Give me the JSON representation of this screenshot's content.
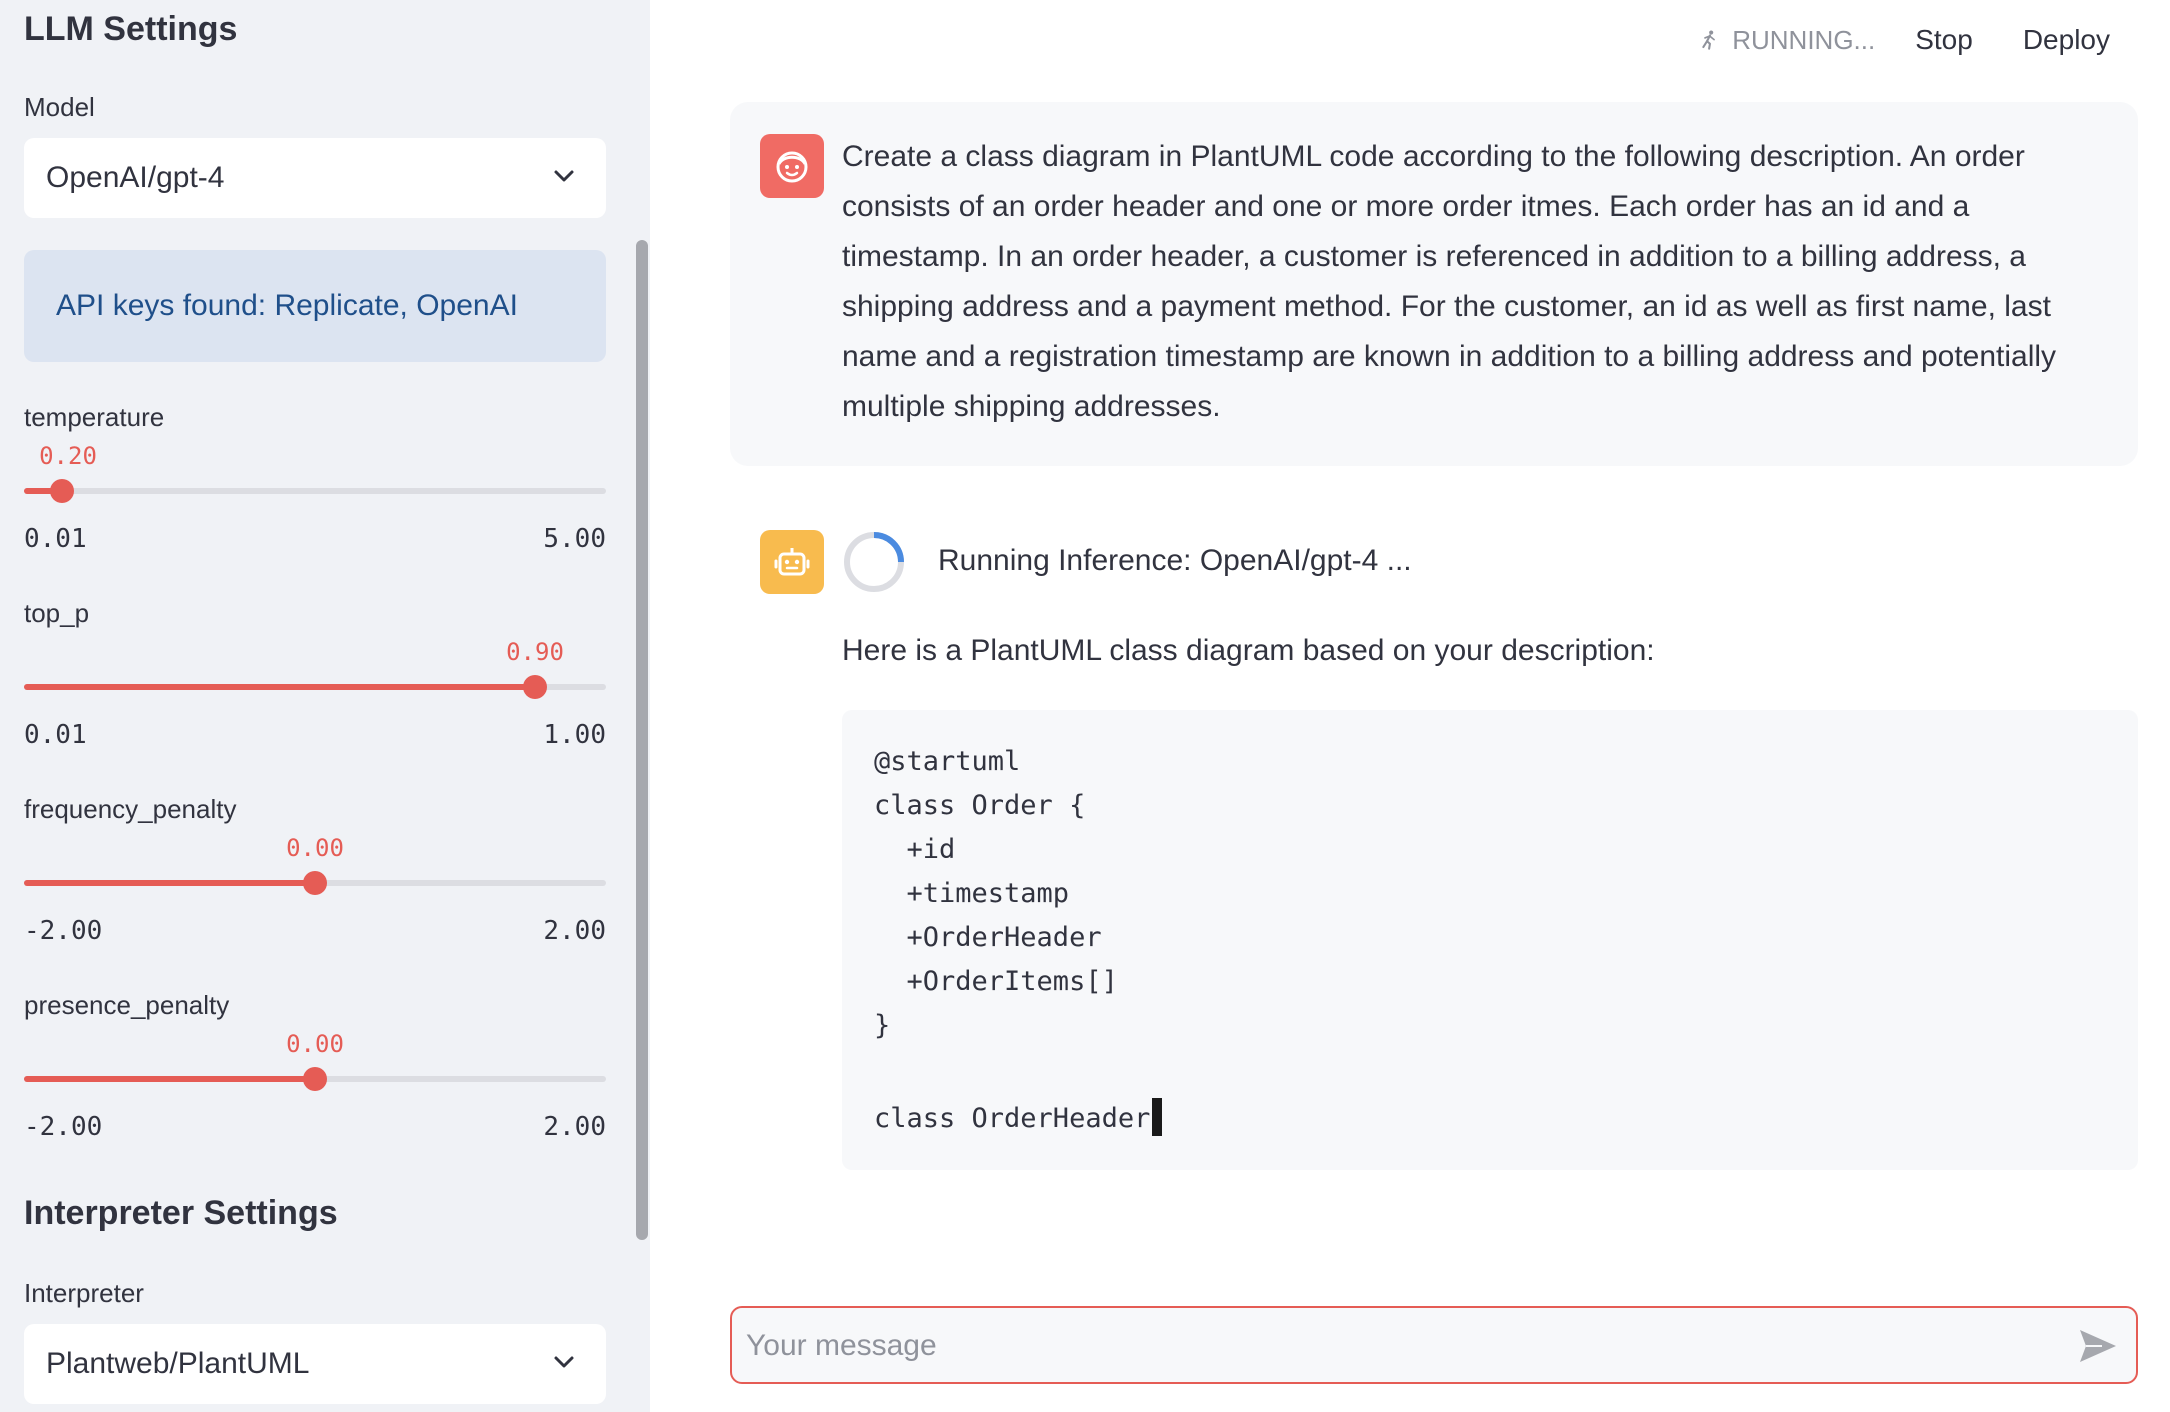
{
  "sidebar": {
    "llm_title": "LLM Settings",
    "model_label": "Model",
    "model_value": "OpenAI/gpt-4",
    "api_info": "API keys found: Replicate, OpenAI",
    "sliders": [
      {
        "label": "temperature",
        "value": "0.20",
        "min": "0.01",
        "max": "5.00",
        "fraction": 0.04
      },
      {
        "label": "top_p",
        "value": "0.90",
        "min": "0.01",
        "max": "1.00",
        "fraction": 0.9
      },
      {
        "label": "frequency_penalty",
        "value": "0.00",
        "min": "-2.00",
        "max": "2.00",
        "fraction": 0.5
      },
      {
        "label": "presence_penalty",
        "value": "0.00",
        "min": "-2.00",
        "max": "2.00",
        "fraction": 0.5
      }
    ],
    "interp_title": "Interpreter Settings",
    "interp_label": "Interpreter",
    "interp_value": "Plantweb/PlantUML"
  },
  "toolbar": {
    "status": "RUNNING...",
    "stop_label": "Stop",
    "deploy_label": "Deploy"
  },
  "chat": {
    "user_message": "Create a class diagram in PlantUML code according to the following description. An order consists of an order header and one or more order itmes. Each order has an id and a timestamp. In an order header, a customer is referenced in addition to a billing address, a shipping address and a payment method. For the customer, an id as well as first name, last name and a registration timestamp are known in addition to a billing address and potentially multiple shipping addresses.",
    "inference_status": "Running Inference: OpenAI/gpt-4 ...",
    "response_intro": "Here is a PlantUML class diagram based on your description:",
    "code_lines": [
      "@startuml",
      "class Order {",
      "  +id",
      "  +timestamp",
      "  +OrderHeader",
      "  +OrderItems[]",
      "}",
      "",
      "class OrderHeader"
    ],
    "input_placeholder": "Your message"
  },
  "colors": {
    "accent": "#e55c55",
    "sidebar_bg": "#f0f2f6",
    "info_bg": "#dce4f1",
    "user_avatar": "#f06b64",
    "bot_avatar": "#f8bb4e"
  },
  "icons": [
    "running-man-icon",
    "chevron-down-icon",
    "user-face-icon",
    "robot-icon",
    "spinner-icon",
    "send-icon"
  ]
}
